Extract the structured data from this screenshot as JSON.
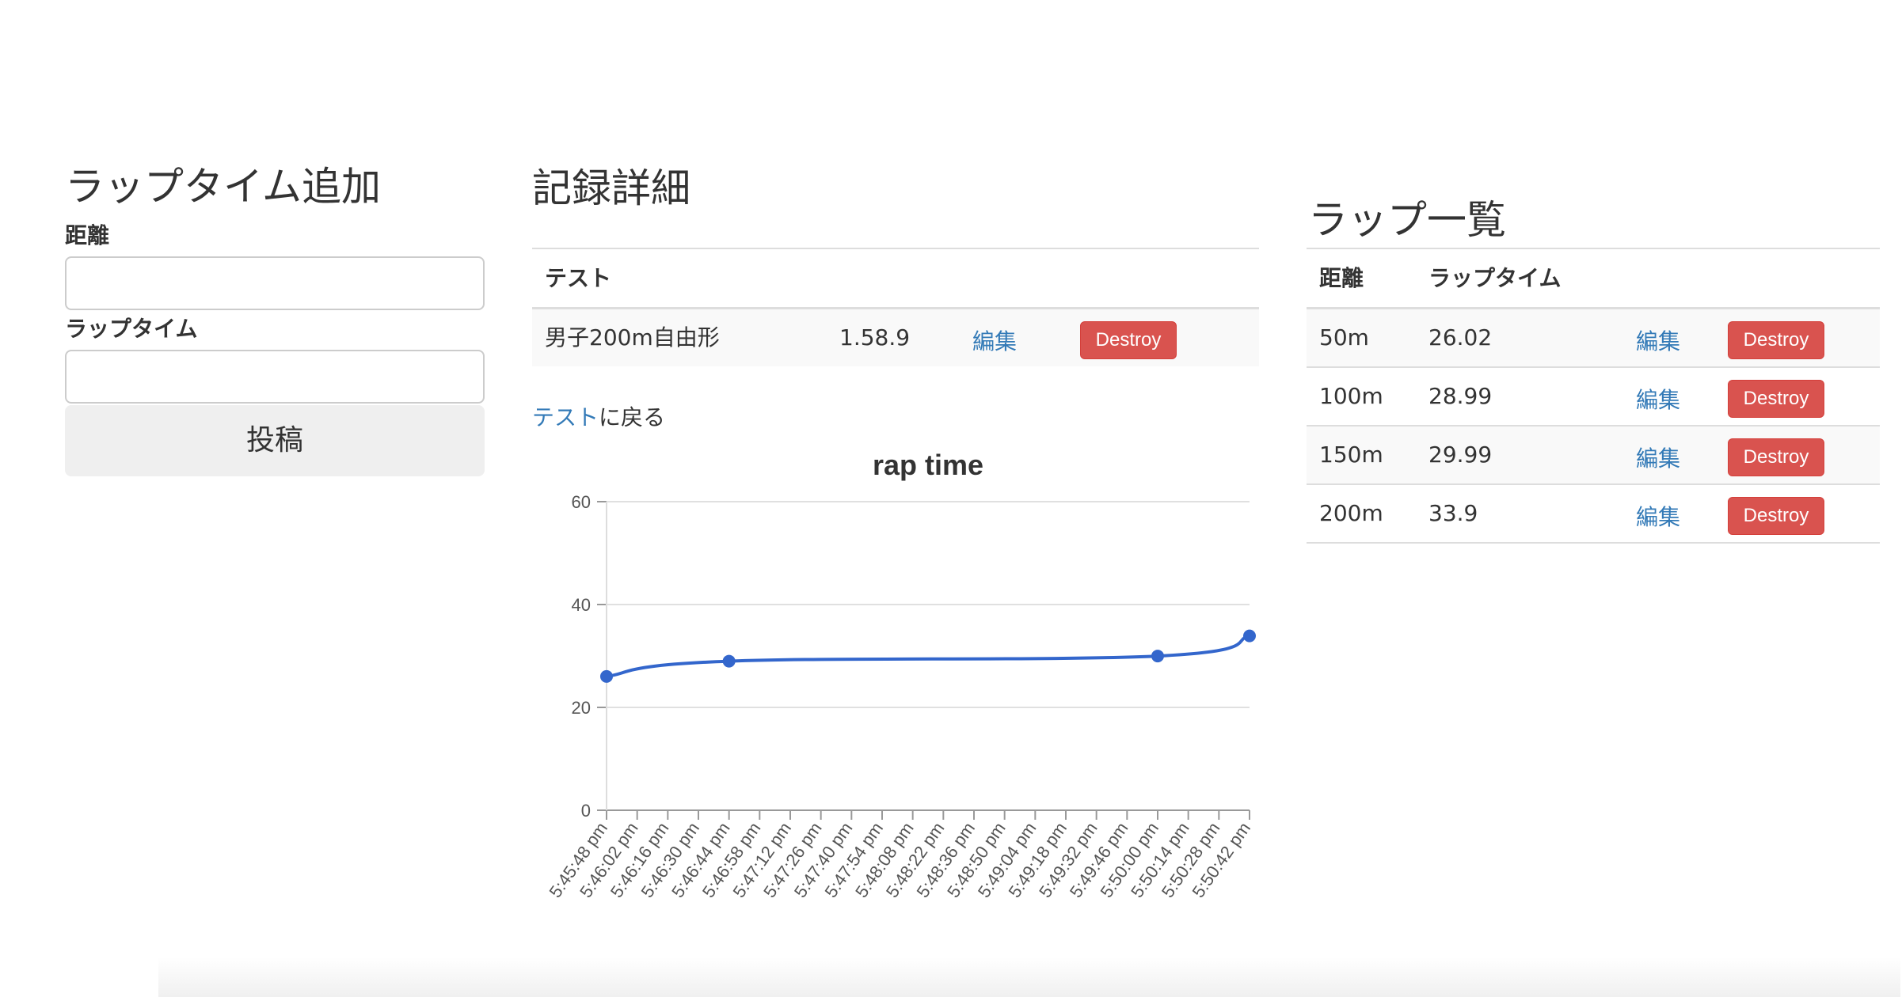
{
  "add_form": {
    "title": "ラップタイム追加",
    "distance_label": "距離",
    "distance_value": "",
    "laptime_label": "ラップタイム",
    "laptime_value": "",
    "submit_label": "投稿"
  },
  "record": {
    "title": "記録詳細",
    "table_header": "テスト",
    "event": "男子200m自由形",
    "time": "1.58.9",
    "edit_label": "編集",
    "destroy_label": "Destroy",
    "back_link": "テスト",
    "back_suffix": "に戻る"
  },
  "lap_list": {
    "title": "ラップ一覧",
    "headers": [
      "距離",
      "ラップタイム"
    ],
    "rows": [
      {
        "distance": "50m",
        "time": "26.02",
        "edit": "編集",
        "destroy": "Destroy"
      },
      {
        "distance": "100m",
        "time": "28.99",
        "edit": "編集",
        "destroy": "Destroy"
      },
      {
        "distance": "150m",
        "time": "29.99",
        "edit": "編集",
        "destroy": "Destroy"
      },
      {
        "distance": "200m",
        "time": "33.9",
        "edit": "編集",
        "destroy": "Destroy"
      }
    ]
  },
  "colors": {
    "accent_link": "#337ab7",
    "danger": "#d9534f",
    "line": "#3366cc"
  },
  "chart_data": {
    "type": "line",
    "title": "rap time",
    "xlabel": "",
    "ylabel": "",
    "ylim": [
      0,
      60
    ],
    "yticks": [
      0,
      20,
      40,
      60
    ],
    "grid": true,
    "x": [
      "5:45:48 pm",
      "5:46:02 pm",
      "5:46:16 pm",
      "5:46:30 pm",
      "5:46:44 pm",
      "5:46:58 pm",
      "5:47:12 pm",
      "5:47:26 pm",
      "5:47:40 pm",
      "5:47:54 pm",
      "5:48:08 pm",
      "5:48:22 pm",
      "5:48:36 pm",
      "5:48:50 pm",
      "5:49:04 pm",
      "5:49:18 pm",
      "5:49:32 pm",
      "5:49:46 pm",
      "5:50:00 pm",
      "5:50:14 pm",
      "5:50:28 pm",
      "5:50:42 pm"
    ],
    "series": [
      {
        "points": [
          {
            "x": "5:45:48 pm",
            "y": 26.02
          },
          {
            "x": "5:46:44 pm",
            "y": 28.99
          },
          {
            "x": "5:50:00 pm",
            "y": 29.99
          },
          {
            "x": "5:50:42 pm",
            "y": 33.9
          }
        ]
      }
    ]
  }
}
